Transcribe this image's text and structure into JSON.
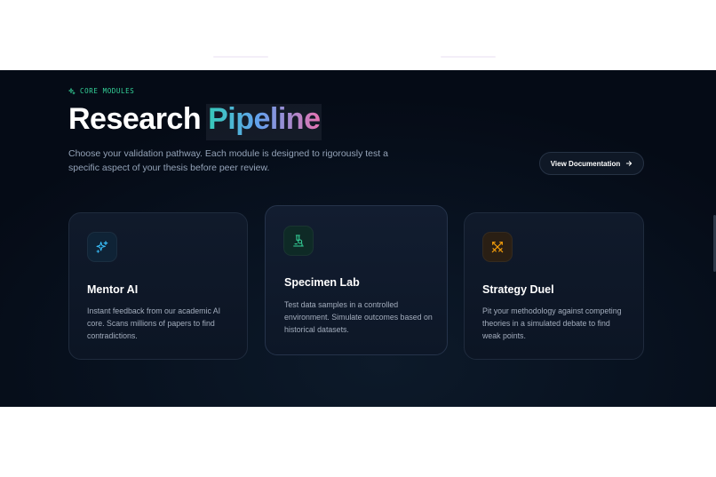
{
  "eyebrow": {
    "label": "CORE MODULES",
    "icon": "sparkle-icon"
  },
  "heading": {
    "main": "Research",
    "accent": "Pipeline"
  },
  "subtitle": "Choose your validation pathway. Each module is designed to rigorously test a specific aspect of your thesis before peer review.",
  "cta": {
    "label": "View Documentation",
    "icon": "arrow-right-icon"
  },
  "colors": {
    "accent_green": "#34d399",
    "gradient": [
      "#2dd4bf",
      "#60a5fa",
      "#f472b6"
    ],
    "mentor_icon": "#38bdf8",
    "specimen_icon": "#34d399",
    "duel_icon": "#f59e0b"
  },
  "modules": [
    {
      "title": "Mentor AI",
      "icon": "sparkles-icon",
      "description": "Instant feedback from our academic AI core. Scans millions of papers to find contradictions."
    },
    {
      "title": "Specimen Lab",
      "icon": "microscope-icon",
      "description": "Test data samples in a controlled environment. Simulate outcomes based on historical datasets."
    },
    {
      "title": "Strategy Duel",
      "icon": "crossed-swords-icon",
      "description": "Pit your methodology against competing theories in a simulated debate to find weak points."
    }
  ]
}
